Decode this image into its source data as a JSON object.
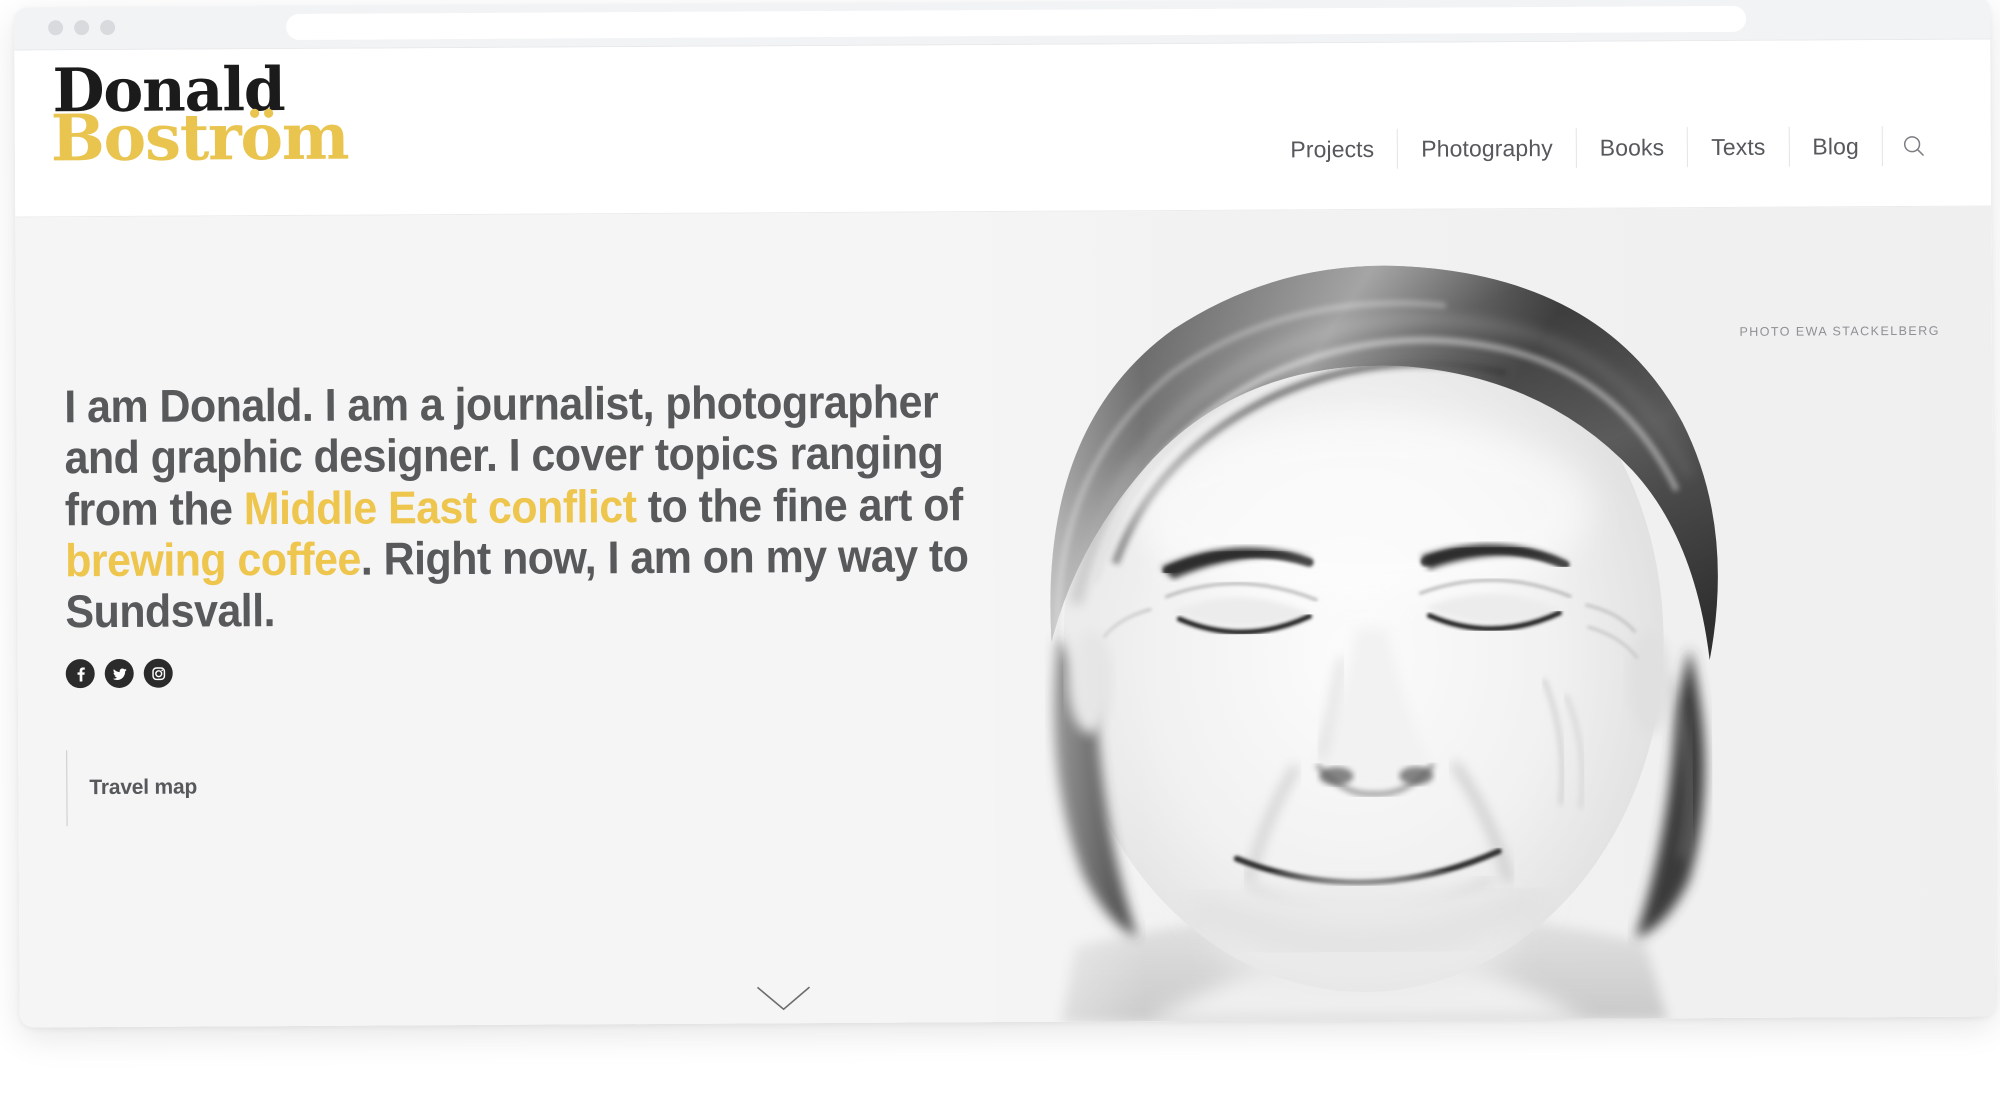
{
  "browser": {
    "url_value": "",
    "url_placeholder": "",
    "traffic_lights": [
      "close-dot",
      "minimize-dot",
      "zoom-dot"
    ]
  },
  "site": {
    "logo": {
      "line1": "Donald",
      "line2": "Boström",
      "line1_color": "#1b1b1b",
      "line2_color": "#e9c44f"
    },
    "nav": {
      "items": [
        {
          "label": "Projects"
        },
        {
          "label": "Photography"
        },
        {
          "label": "Books"
        },
        {
          "label": "Texts"
        },
        {
          "label": "Blog"
        }
      ],
      "search_icon": "search-icon"
    }
  },
  "hero": {
    "photo_credit": "PHOTO EWA STACKELBERG",
    "headline": {
      "part1": "I am Donald. I am a journalist, photographer and graphic designer. I cover topics ranging from the ",
      "link1": "Middle East conflict",
      "part2": " to the fine art of ",
      "link2": "brewing coffee",
      "part3": ". Right now, I am on my way to Sundsvall."
    },
    "social": [
      {
        "name": "facebook-icon",
        "label": "Facebook"
      },
      {
        "name": "twitter-icon",
        "label": "Twitter"
      },
      {
        "name": "instagram-icon",
        "label": "Instagram"
      }
    ],
    "travel_map_label": "Travel map",
    "scroll_hint": "chevron-down-icon"
  },
  "colors": {
    "accent_yellow": "#eec54d",
    "logo_yellow": "#e9c44f",
    "text_gray": "#58595b",
    "nav_gray": "#56585c",
    "hero_bg": "#f5f5f5",
    "header_bg": "#ffffff",
    "social_bg": "#2b2b2b"
  }
}
